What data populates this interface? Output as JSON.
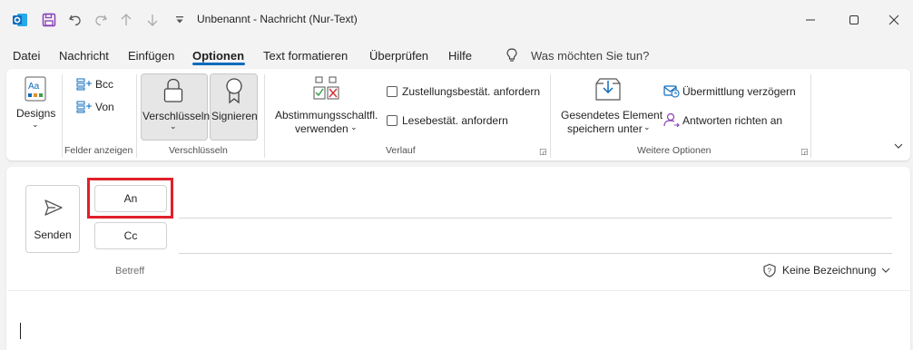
{
  "app": {
    "title": "Unbenannt  -  Nachricht (Nur-Text)"
  },
  "colors": {
    "accent": "#0f6cbd",
    "outlook_blue": "#0f6cbd",
    "save_purple": "#8b3fb8",
    "highlight_red": "#e0202a",
    "pressed_bg": "#e6e6e6"
  },
  "quick_access": [
    "outlook-app-icon",
    "save-icon",
    "undo-icon",
    "redo-icon",
    "up-icon",
    "down-icon",
    "customize-qat-icon"
  ],
  "window_controls": [
    "minimize",
    "maximize",
    "close"
  ],
  "menu": {
    "items": [
      "Datei",
      "Nachricht",
      "Einfügen",
      "Optionen",
      "Text formatieren",
      "Überprüfen",
      "Hilfe"
    ],
    "active": "Optionen",
    "tell_me": "Was möchten Sie tun?"
  },
  "ribbon": {
    "designs": "Designs",
    "bcc": "Bcc",
    "von": "Von",
    "felder_anzeigen": "Felder anzeigen",
    "verschluesseln": "Verschlüsseln",
    "signieren": "Signieren",
    "verschluesseln_group": "Verschlüsseln",
    "abstimmung_line1": "Abstimmungsschaltfl.",
    "abstimmung_line2": "verwenden",
    "zustellung": "Zustellungsbestät. anfordern",
    "lesebest": "Lesebestät. anfordern",
    "verlauf": "Verlauf",
    "gesendetes_line1": "Gesendetes Element",
    "gesendetes_line2": "speichern unter",
    "uebermittlung": "Übermittlung verzögern",
    "antworten": "Antworten richten an",
    "weitere_optionen": "Weitere Optionen"
  },
  "compose": {
    "send": "Senden",
    "to": "An",
    "cc": "Cc",
    "subject_placeholder": "Betreff",
    "sensitivity": "Keine Bezeichnung"
  }
}
